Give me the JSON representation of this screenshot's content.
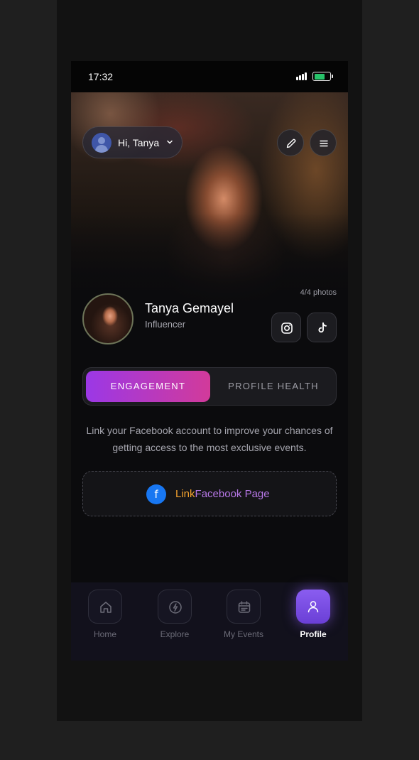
{
  "status_bar": {
    "time": "17:32"
  },
  "header": {
    "greeting": "Hi, Tanya"
  },
  "profile": {
    "name": "Tanya Gemayel",
    "role": "Influencer",
    "photo_count": "4/4 photos"
  },
  "tabs_segment": {
    "active_label": "ENGAGEMENT",
    "inactive_label": "PROFILE HEALTH"
  },
  "info": {
    "text": "Link your Facebook account to improve your chances of getting access to the most exclusive events."
  },
  "facebook_card": {
    "label_part1": "Link",
    "label_part2": "Facebook Page",
    "icon_letter": "f"
  },
  "nav": {
    "items": [
      {
        "label": "Home",
        "icon": "home-icon"
      },
      {
        "label": "Explore",
        "icon": "lightning-icon"
      },
      {
        "label": "My Events",
        "icon": "calendar-icon"
      },
      {
        "label": "Profile",
        "icon": "user-icon"
      }
    ],
    "active": "Profile"
  },
  "colors": {
    "accent_gradient_start": "#9b38e6",
    "accent_gradient_end": "#d23a9a",
    "facebook_blue": "#1877f2",
    "link_orange": "#f3a22e",
    "link_purple": "#b677e6",
    "battery_green": "#27c36a",
    "nav_active": "#7c4fe6"
  }
}
